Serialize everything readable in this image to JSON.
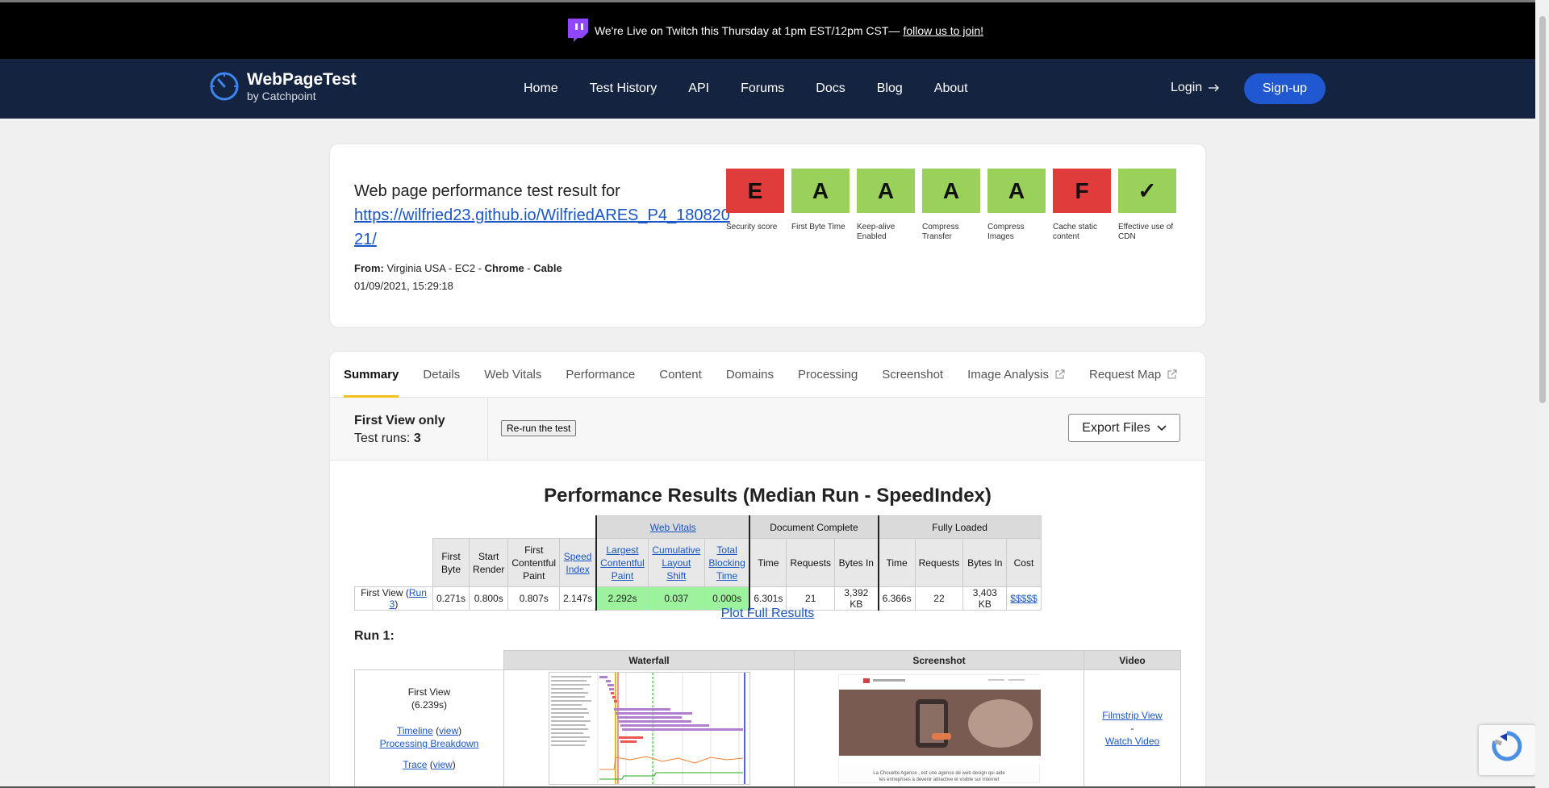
{
  "promo": {
    "text": "We're Live on Twitch this Thursday at 1pm EST/12pm CST—",
    "link": "follow us to join!"
  },
  "nav": {
    "brand": "WebPageTest",
    "brand_sub": "by Catchpoint",
    "links": [
      "Home",
      "Test History",
      "API",
      "Forums",
      "Docs",
      "Blog",
      "About"
    ],
    "login": "Login",
    "signup": "Sign-up"
  },
  "result": {
    "heading": "Web page performance test result for",
    "url": "https://wilfried23.github.io/WilfriedARES_P4_18082021/",
    "from_label": "From:",
    "location": "Virginia USA - EC2 - ",
    "browser": "Chrome",
    "sep": " - ",
    "connection": "Cable",
    "datetime": "01/09/2021, 15:29:18"
  },
  "grades": [
    {
      "grade": "E",
      "label": "Security score",
      "color": "#e13c3c"
    },
    {
      "grade": "A",
      "label": "First Byte Time",
      "color": "#9ad15a"
    },
    {
      "grade": "A",
      "label": "Keep-alive Enabled",
      "color": "#9ad15a"
    },
    {
      "grade": "A",
      "label": "Compress Transfer",
      "color": "#9ad15a"
    },
    {
      "grade": "A",
      "label": "Compress Images",
      "color": "#9ad15a"
    },
    {
      "grade": "F",
      "label": "Cache static content",
      "color": "#e13c3c"
    },
    {
      "grade": "✓",
      "label": "Effective use of CDN",
      "color": "#9ad15a"
    }
  ],
  "tabs": [
    "Summary",
    "Details",
    "Web Vitals",
    "Performance",
    "Content",
    "Domains",
    "Processing",
    "Screenshot",
    "Image Analysis",
    "Request Map"
  ],
  "summary": {
    "view": "First View only",
    "runs_label": "Test runs: ",
    "runs": "3",
    "rerun": "Re-run the test",
    "export": "Export Files"
  },
  "perf": {
    "title": "Performance Results (Median Run - SpeedIndex)",
    "groups": {
      "web_vitals": "Web Vitals",
      "doc_complete": "Document Complete",
      "fully_loaded": "Fully Loaded"
    },
    "headers": {
      "first_byte": "First Byte",
      "start_render": "Start Render",
      "fcp": "First Contentful Paint",
      "speed_index": "Speed Index",
      "lcp": "Largest Contentful Paint",
      "cls": "Cumulative Layout Shift",
      "tbt": "Total Blocking Time",
      "time": "Time",
      "requests": "Requests",
      "bytes_in": "Bytes In",
      "cost": "Cost"
    },
    "row": {
      "label": "First View (",
      "run_link": "Run 3",
      "label_end": ")",
      "first_byte": "0.271s",
      "start_render": "0.800s",
      "fcp": "0.807s",
      "speed_index": "2.147s",
      "lcp": "2.292s",
      "cls": "0.037",
      "tbt": "0.000s",
      "dc_time": "6.301s",
      "dc_requests": "21",
      "dc_bytes": "3,392 KB",
      "fl_time": "6.366s",
      "fl_requests": "22",
      "fl_bytes": "3,403 KB",
      "cost": "$$$$$"
    },
    "plot_link": "Plot Full Results"
  },
  "run1": {
    "title": "Run 1:",
    "headers": {
      "waterfall": "Waterfall",
      "screenshot": "Screenshot",
      "video": "Video"
    },
    "first_view": "First View",
    "time": "(6.239s)",
    "timeline": "Timeline",
    "view": "view",
    "processing": "Processing Breakdown",
    "trace": "Trace",
    "filmstrip": "Filmstrip View",
    "dash": "-",
    "watch": "Watch Video",
    "shot_caption": "La Chouette Agence , est une agence de web design qui aide les entreprises à devenir attractive et visible sur Internet"
  }
}
